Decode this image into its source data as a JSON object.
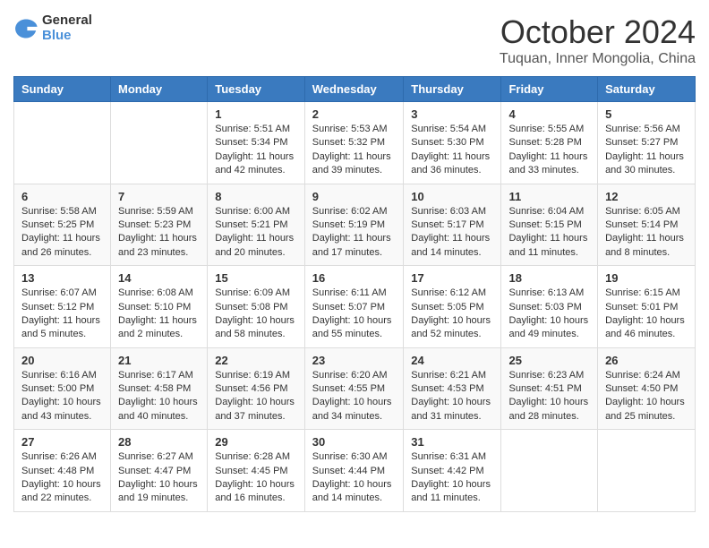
{
  "logo": {
    "text_general": "General",
    "text_blue": "Blue"
  },
  "header": {
    "month": "October 2024",
    "location": "Tuquan, Inner Mongolia, China"
  },
  "weekdays": [
    "Sunday",
    "Monday",
    "Tuesday",
    "Wednesday",
    "Thursday",
    "Friday",
    "Saturday"
  ],
  "weeks": [
    [
      {
        "day": "",
        "sunrise": "",
        "sunset": "",
        "daylight": ""
      },
      {
        "day": "",
        "sunrise": "",
        "sunset": "",
        "daylight": ""
      },
      {
        "day": "1",
        "sunrise": "Sunrise: 5:51 AM",
        "sunset": "Sunset: 5:34 PM",
        "daylight": "Daylight: 11 hours and 42 minutes."
      },
      {
        "day": "2",
        "sunrise": "Sunrise: 5:53 AM",
        "sunset": "Sunset: 5:32 PM",
        "daylight": "Daylight: 11 hours and 39 minutes."
      },
      {
        "day": "3",
        "sunrise": "Sunrise: 5:54 AM",
        "sunset": "Sunset: 5:30 PM",
        "daylight": "Daylight: 11 hours and 36 minutes."
      },
      {
        "day": "4",
        "sunrise": "Sunrise: 5:55 AM",
        "sunset": "Sunset: 5:28 PM",
        "daylight": "Daylight: 11 hours and 33 minutes."
      },
      {
        "day": "5",
        "sunrise": "Sunrise: 5:56 AM",
        "sunset": "Sunset: 5:27 PM",
        "daylight": "Daylight: 11 hours and 30 minutes."
      }
    ],
    [
      {
        "day": "6",
        "sunrise": "Sunrise: 5:58 AM",
        "sunset": "Sunset: 5:25 PM",
        "daylight": "Daylight: 11 hours and 26 minutes."
      },
      {
        "day": "7",
        "sunrise": "Sunrise: 5:59 AM",
        "sunset": "Sunset: 5:23 PM",
        "daylight": "Daylight: 11 hours and 23 minutes."
      },
      {
        "day": "8",
        "sunrise": "Sunrise: 6:00 AM",
        "sunset": "Sunset: 5:21 PM",
        "daylight": "Daylight: 11 hours and 20 minutes."
      },
      {
        "day": "9",
        "sunrise": "Sunrise: 6:02 AM",
        "sunset": "Sunset: 5:19 PM",
        "daylight": "Daylight: 11 hours and 17 minutes."
      },
      {
        "day": "10",
        "sunrise": "Sunrise: 6:03 AM",
        "sunset": "Sunset: 5:17 PM",
        "daylight": "Daylight: 11 hours and 14 minutes."
      },
      {
        "day": "11",
        "sunrise": "Sunrise: 6:04 AM",
        "sunset": "Sunset: 5:15 PM",
        "daylight": "Daylight: 11 hours and 11 minutes."
      },
      {
        "day": "12",
        "sunrise": "Sunrise: 6:05 AM",
        "sunset": "Sunset: 5:14 PM",
        "daylight": "Daylight: 11 hours and 8 minutes."
      }
    ],
    [
      {
        "day": "13",
        "sunrise": "Sunrise: 6:07 AM",
        "sunset": "Sunset: 5:12 PM",
        "daylight": "Daylight: 11 hours and 5 minutes."
      },
      {
        "day": "14",
        "sunrise": "Sunrise: 6:08 AM",
        "sunset": "Sunset: 5:10 PM",
        "daylight": "Daylight: 11 hours and 2 minutes."
      },
      {
        "day": "15",
        "sunrise": "Sunrise: 6:09 AM",
        "sunset": "Sunset: 5:08 PM",
        "daylight": "Daylight: 10 hours and 58 minutes."
      },
      {
        "day": "16",
        "sunrise": "Sunrise: 6:11 AM",
        "sunset": "Sunset: 5:07 PM",
        "daylight": "Daylight: 10 hours and 55 minutes."
      },
      {
        "day": "17",
        "sunrise": "Sunrise: 6:12 AM",
        "sunset": "Sunset: 5:05 PM",
        "daylight": "Daylight: 10 hours and 52 minutes."
      },
      {
        "day": "18",
        "sunrise": "Sunrise: 6:13 AM",
        "sunset": "Sunset: 5:03 PM",
        "daylight": "Daylight: 10 hours and 49 minutes."
      },
      {
        "day": "19",
        "sunrise": "Sunrise: 6:15 AM",
        "sunset": "Sunset: 5:01 PM",
        "daylight": "Daylight: 10 hours and 46 minutes."
      }
    ],
    [
      {
        "day": "20",
        "sunrise": "Sunrise: 6:16 AM",
        "sunset": "Sunset: 5:00 PM",
        "daylight": "Daylight: 10 hours and 43 minutes."
      },
      {
        "day": "21",
        "sunrise": "Sunrise: 6:17 AM",
        "sunset": "Sunset: 4:58 PM",
        "daylight": "Daylight: 10 hours and 40 minutes."
      },
      {
        "day": "22",
        "sunrise": "Sunrise: 6:19 AM",
        "sunset": "Sunset: 4:56 PM",
        "daylight": "Daylight: 10 hours and 37 minutes."
      },
      {
        "day": "23",
        "sunrise": "Sunrise: 6:20 AM",
        "sunset": "Sunset: 4:55 PM",
        "daylight": "Daylight: 10 hours and 34 minutes."
      },
      {
        "day": "24",
        "sunrise": "Sunrise: 6:21 AM",
        "sunset": "Sunset: 4:53 PM",
        "daylight": "Daylight: 10 hours and 31 minutes."
      },
      {
        "day": "25",
        "sunrise": "Sunrise: 6:23 AM",
        "sunset": "Sunset: 4:51 PM",
        "daylight": "Daylight: 10 hours and 28 minutes."
      },
      {
        "day": "26",
        "sunrise": "Sunrise: 6:24 AM",
        "sunset": "Sunset: 4:50 PM",
        "daylight": "Daylight: 10 hours and 25 minutes."
      }
    ],
    [
      {
        "day": "27",
        "sunrise": "Sunrise: 6:26 AM",
        "sunset": "Sunset: 4:48 PM",
        "daylight": "Daylight: 10 hours and 22 minutes."
      },
      {
        "day": "28",
        "sunrise": "Sunrise: 6:27 AM",
        "sunset": "Sunset: 4:47 PM",
        "daylight": "Daylight: 10 hours and 19 minutes."
      },
      {
        "day": "29",
        "sunrise": "Sunrise: 6:28 AM",
        "sunset": "Sunset: 4:45 PM",
        "daylight": "Daylight: 10 hours and 16 minutes."
      },
      {
        "day": "30",
        "sunrise": "Sunrise: 6:30 AM",
        "sunset": "Sunset: 4:44 PM",
        "daylight": "Daylight: 10 hours and 14 minutes."
      },
      {
        "day": "31",
        "sunrise": "Sunrise: 6:31 AM",
        "sunset": "Sunset: 4:42 PM",
        "daylight": "Daylight: 10 hours and 11 minutes."
      },
      {
        "day": "",
        "sunrise": "",
        "sunset": "",
        "daylight": ""
      },
      {
        "day": "",
        "sunrise": "",
        "sunset": "",
        "daylight": ""
      }
    ]
  ]
}
